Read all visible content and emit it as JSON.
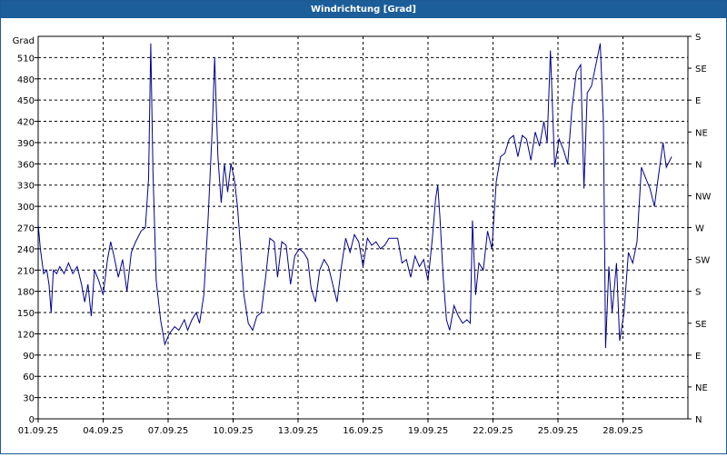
{
  "window": {
    "title": "Windrichtung [Grad]"
  },
  "chart_data": {
    "type": "line",
    "title": "Windrichtung [Grad]",
    "ylabel": "Grad",
    "ylim": [
      0,
      540
    ],
    "yticks": [
      0,
      30,
      60,
      90,
      120,
      150,
      180,
      210,
      240,
      270,
      300,
      330,
      360,
      390,
      420,
      450,
      480,
      510
    ],
    "xlim": [
      "01.09.25",
      "30.09.25"
    ],
    "xticks": [
      "01.09.25",
      "04.09.25",
      "07.09.25",
      "10.09.25",
      "13.09.25",
      "16.09.25",
      "19.09.25",
      "22.09.25",
      "25.09.25",
      "28.09.25"
    ],
    "right_axis": [
      "S",
      "SE",
      "E",
      "NE",
      "N",
      "NW",
      "W",
      "SW",
      "S",
      "SE",
      "E",
      "NE",
      "N"
    ],
    "grid": true,
    "colors": {
      "line": "#00008b",
      "grid": "#000000",
      "frame": "#000000",
      "title_bar": "#1b5e9a"
    },
    "series": [
      {
        "values": [
          [
            0.0,
            275
          ],
          [
            0.1,
            240
          ],
          [
            0.25,
            205
          ],
          [
            0.4,
            210
          ],
          [
            0.5,
            190
          ],
          [
            0.6,
            150
          ],
          [
            0.7,
            210
          ],
          [
            0.85,
            205
          ],
          [
            1.0,
            215
          ],
          [
            1.2,
            205
          ],
          [
            1.4,
            220
          ],
          [
            1.6,
            205
          ],
          [
            1.8,
            215
          ],
          [
            2.0,
            190
          ],
          [
            2.15,
            165
          ],
          [
            2.3,
            190
          ],
          [
            2.45,
            145
          ],
          [
            2.6,
            210
          ],
          [
            2.8,
            195
          ],
          [
            3.0,
            175
          ],
          [
            3.2,
            225
          ],
          [
            3.35,
            250
          ],
          [
            3.5,
            230
          ],
          [
            3.7,
            200
          ],
          [
            3.9,
            225
          ],
          [
            4.1,
            180
          ],
          [
            4.3,
            235
          ],
          [
            4.5,
            250
          ],
          [
            4.75,
            265
          ],
          [
            4.95,
            270
          ],
          [
            5.1,
            340
          ],
          [
            5.2,
            530
          ],
          [
            5.3,
            350
          ],
          [
            5.45,
            195
          ],
          [
            5.65,
            140
          ],
          [
            5.85,
            105
          ],
          [
            6.05,
            120
          ],
          [
            6.3,
            130
          ],
          [
            6.5,
            125
          ],
          [
            6.75,
            140
          ],
          [
            6.9,
            125
          ],
          [
            7.1,
            140
          ],
          [
            7.3,
            150
          ],
          [
            7.45,
            135
          ],
          [
            7.65,
            175
          ],
          [
            7.85,
            285
          ],
          [
            8.05,
            420
          ],
          [
            8.15,
            510
          ],
          [
            8.3,
            370
          ],
          [
            8.45,
            305
          ],
          [
            8.6,
            360
          ],
          [
            8.75,
            320
          ],
          [
            8.9,
            360
          ],
          [
            9.05,
            340
          ],
          [
            9.2,
            300
          ],
          [
            9.35,
            240
          ],
          [
            9.5,
            175
          ],
          [
            9.7,
            135
          ],
          [
            9.9,
            125
          ],
          [
            10.1,
            145
          ],
          [
            10.3,
            150
          ],
          [
            10.5,
            200
          ],
          [
            10.7,
            255
          ],
          [
            10.9,
            250
          ],
          [
            11.05,
            200
          ],
          [
            11.25,
            250
          ],
          [
            11.45,
            245
          ],
          [
            11.65,
            190
          ],
          [
            11.85,
            230
          ],
          [
            12.05,
            240
          ],
          [
            12.25,
            235
          ],
          [
            12.45,
            225
          ],
          [
            12.6,
            185
          ],
          [
            12.8,
            165
          ],
          [
            13.0,
            210
          ],
          [
            13.2,
            225
          ],
          [
            13.4,
            215
          ],
          [
            13.6,
            190
          ],
          [
            13.8,
            165
          ],
          [
            14.0,
            215
          ],
          [
            14.2,
            255
          ],
          [
            14.4,
            235
          ],
          [
            14.6,
            260
          ],
          [
            14.8,
            250
          ],
          [
            15.0,
            215
          ],
          [
            15.2,
            255
          ],
          [
            15.4,
            245
          ],
          [
            15.6,
            250
          ],
          [
            15.8,
            240
          ],
          [
            16.0,
            245
          ],
          [
            16.2,
            255
          ],
          [
            16.4,
            255
          ],
          [
            16.6,
            255
          ],
          [
            16.8,
            220
          ],
          [
            17.0,
            225
          ],
          [
            17.2,
            200
          ],
          [
            17.4,
            230
          ],
          [
            17.6,
            215
          ],
          [
            17.8,
            225
          ],
          [
            18.0,
            195
          ],
          [
            18.2,
            255
          ],
          [
            18.35,
            310
          ],
          [
            18.45,
            330
          ],
          [
            18.55,
            285
          ],
          [
            18.7,
            200
          ],
          [
            18.85,
            140
          ],
          [
            19.0,
            125
          ],
          [
            19.2,
            160
          ],
          [
            19.4,
            145
          ],
          [
            19.6,
            135
          ],
          [
            19.8,
            140
          ],
          [
            19.95,
            135
          ],
          [
            20.05,
            280
          ],
          [
            20.2,
            175
          ],
          [
            20.35,
            220
          ],
          [
            20.55,
            210
          ],
          [
            20.75,
            265
          ],
          [
            20.95,
            240
          ],
          [
            21.15,
            335
          ],
          [
            21.35,
            370
          ],
          [
            21.55,
            375
          ],
          [
            21.75,
            395
          ],
          [
            21.95,
            400
          ],
          [
            22.15,
            370
          ],
          [
            22.35,
            400
          ],
          [
            22.55,
            395
          ],
          [
            22.75,
            365
          ],
          [
            22.95,
            405
          ],
          [
            23.15,
            385
          ],
          [
            23.35,
            420
          ],
          [
            23.5,
            390
          ],
          [
            23.65,
            520
          ],
          [
            23.85,
            355
          ],
          [
            24.05,
            395
          ],
          [
            24.25,
            380
          ],
          [
            24.45,
            360
          ],
          [
            24.65,
            440
          ],
          [
            24.85,
            490
          ],
          [
            25.05,
            500
          ],
          [
            25.2,
            325
          ],
          [
            25.35,
            460
          ],
          [
            25.55,
            470
          ],
          [
            25.75,
            500
          ],
          [
            25.95,
            530
          ],
          [
            26.1,
            420
          ],
          [
            26.2,
            100
          ],
          [
            26.35,
            215
          ],
          [
            26.5,
            150
          ],
          [
            26.7,
            220
          ],
          [
            26.85,
            110
          ],
          [
            27.05,
            150
          ],
          [
            27.25,
            235
          ],
          [
            27.45,
            220
          ],
          [
            27.65,
            250
          ],
          [
            27.85,
            355
          ],
          [
            28.05,
            340
          ],
          [
            28.25,
            325
          ],
          [
            28.45,
            300
          ],
          [
            28.65,
            345
          ],
          [
            28.85,
            390
          ],
          [
            29.0,
            355
          ],
          [
            29.25,
            370
          ]
        ]
      }
    ]
  }
}
